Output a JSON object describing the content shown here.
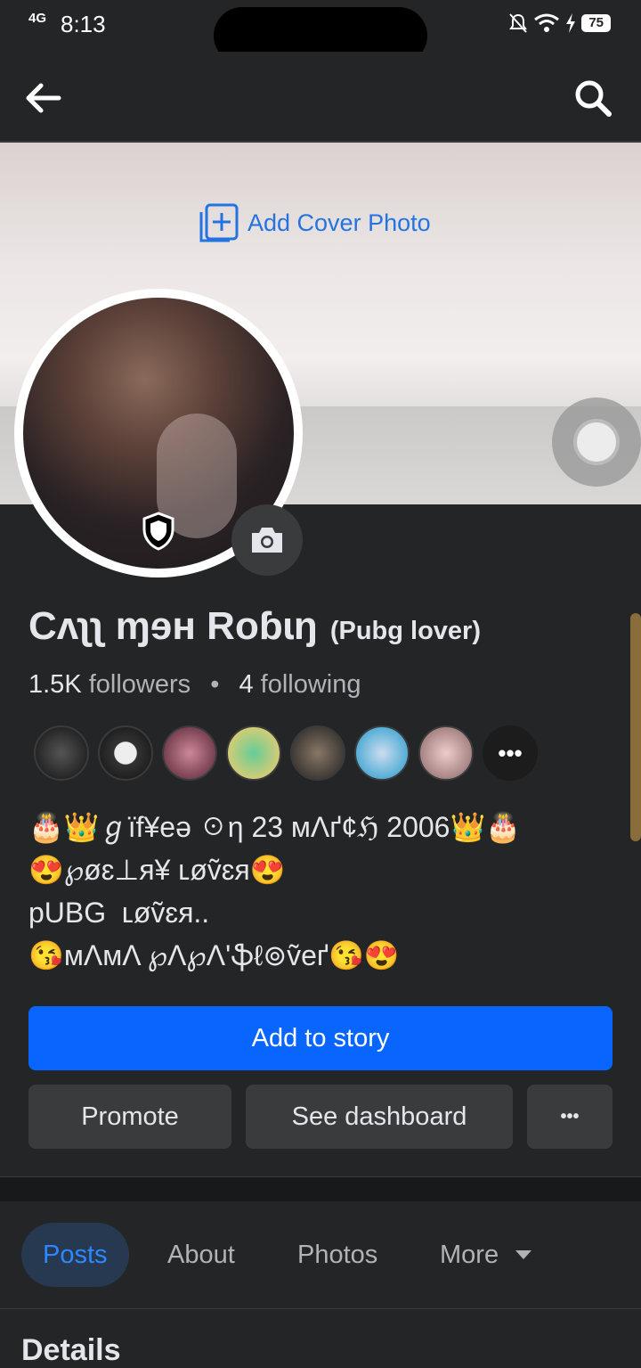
{
  "status_bar": {
    "network": "4G",
    "time": "8:13",
    "battery": "75"
  },
  "header": {
    "back_label": "Back",
    "search_label": "Search"
  },
  "cover": {
    "add_cover_label": "Add Cover Photo"
  },
  "profile": {
    "name": "Cʌʅʅ ɱɘʜ Roɓɩŋ",
    "alt_name": "(Pubg lover)",
    "followers_count": "1.5K",
    "followers_label": "followers",
    "separator": "•",
    "following_count": "4",
    "following_label": "following",
    "friends_more_label": "•••",
    "bio_lines": [
      "🎂👑ℊïf¥eə ☉η 23 мΛґ¢ℌ 2006👑🎂",
      "😍℘øɛ⊥я¥ ʟøṽɛя😍",
      "pUBG  ʟøṽɛя..",
      "😘мΛмΛ ℘Λ℘Λ'ֆℓ⊚ṽeґ😘😍"
    ]
  },
  "actions": {
    "add_to_story": "Add to story",
    "promote": "Promote",
    "see_dashboard": "See dashboard",
    "more": "•••"
  },
  "tabs": [
    {
      "label": "Posts",
      "active": true
    },
    {
      "label": "About",
      "active": false
    },
    {
      "label": "Photos",
      "active": false
    },
    {
      "label": "More",
      "active": false
    }
  ],
  "details_heading": "Details",
  "colors": {
    "background": "#242526",
    "primary_blue": "#0866ff",
    "link_blue": "#2374e1",
    "secondary_button": "#3a3b3c",
    "text": "#e4e6eb",
    "muted_text": "#b0b3b8"
  },
  "friend_avatars": [
    "friend-avatar-1",
    "friend-avatar-2",
    "friend-avatar-3",
    "friend-avatar-4",
    "friend-avatar-5",
    "friend-avatar-6",
    "friend-avatar-7"
  ]
}
